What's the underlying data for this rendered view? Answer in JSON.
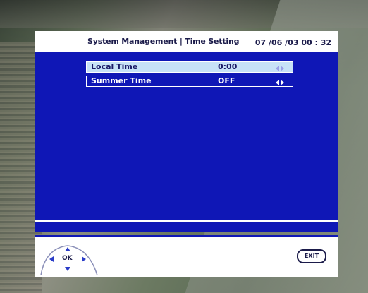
{
  "header": {
    "title": "System Management | Time Setting",
    "clock": "07 /06 /03 00 : 32"
  },
  "settings": [
    {
      "label": "Local Time",
      "value": "0:00",
      "selected": true
    },
    {
      "label": "Summer Time",
      "value": "OFF",
      "selected": false
    }
  ],
  "footer": {
    "ok_label": "OK",
    "exit_label": "EXIT"
  },
  "colors": {
    "panel_blue": "#0f17b6",
    "selected_row": "#c7e2f7",
    "text_dark": "#1b1b4a"
  },
  "icons": {
    "row_arrows": "left-right-arrows-icon",
    "nav_pad": "direction-pad-icon"
  }
}
